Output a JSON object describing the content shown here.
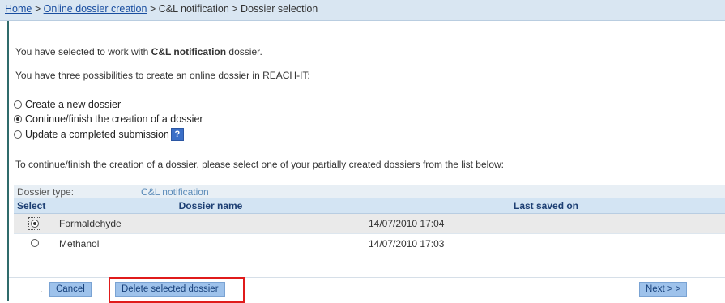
{
  "breadcrumb": {
    "home": "Home",
    "sep1": " > ",
    "online": "Online dossier creation",
    "sep2": " > ",
    "cl": "C&L notification",
    "sep3": " > ",
    "current": "Dossier selection"
  },
  "intro": {
    "prefix": "You have selected to work with ",
    "dossier_type": "C&L notification",
    "suffix": " dossier."
  },
  "possibilities_text": "You have three possibilities to create an online dossier in REACH-IT:",
  "options": [
    {
      "label": "Create a new dossier",
      "checked": false
    },
    {
      "label": "Continue/finish the creation of a dossier",
      "checked": true
    },
    {
      "label": "Update a completed submission",
      "checked": false
    }
  ],
  "help_label": "?",
  "instruction": "To continue/finish the creation of a dossier, please select one of your partially created dossiers from the list below:",
  "table": {
    "type_label": "Dossier type:",
    "type_value": "C&L notification",
    "headers": {
      "select": "Select",
      "name": "Dossier name",
      "saved": "Last saved on"
    },
    "rows": [
      {
        "name": "Formaldehyde",
        "saved": "14/07/2010 17:04",
        "selected": true
      },
      {
        "name": "Methanol",
        "saved": "14/07/2010 17:03",
        "selected": false
      }
    ]
  },
  "buttons": {
    "dot": ".",
    "cancel": "Cancel",
    "delete": "Delete selected dossier",
    "next": "Next > >"
  },
  "colors": {
    "highlight": "#e01b1b",
    "button": "#9ec2eb",
    "header": "#d3e4f3"
  }
}
